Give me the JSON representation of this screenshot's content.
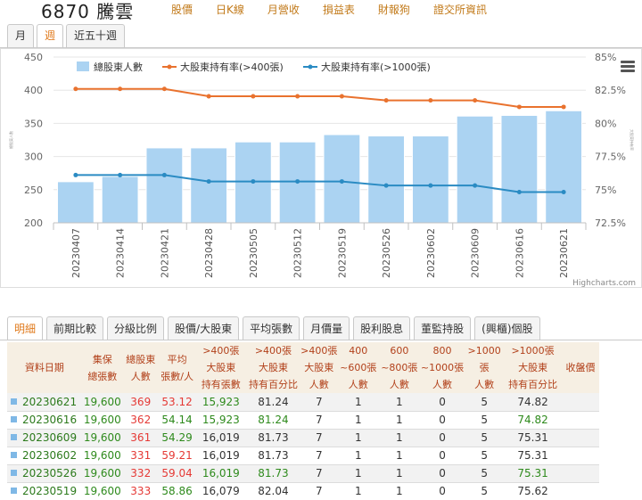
{
  "header": {
    "title": "6870 騰雲",
    "nav": [
      "股價",
      "日K線",
      "月營收",
      "損益表",
      "財報狗",
      "證交所資訊"
    ]
  },
  "period_tabs": [
    {
      "label": "月",
      "active": false
    },
    {
      "label": "週",
      "active": true
    },
    {
      "label": "近五十週",
      "active": false
    }
  ],
  "chart": {
    "credits": "Highcharts.com",
    "legend": {
      "bar": "總股東人數",
      "line400": "大股東持有率(>400張)",
      "line1000": "大股東持有率(>1000張)"
    },
    "left_axis_title": "總股東人數",
    "right_axis_title": "大股東持有率"
  },
  "chart_data": {
    "type": "bar",
    "categories": [
      "20230407",
      "20230414",
      "20230421",
      "20230428",
      "20230505",
      "20230512",
      "20230519",
      "20230526",
      "20230602",
      "20230609",
      "20230616",
      "20230621"
    ],
    "ylim": [
      200,
      450
    ],
    "yticks": [
      200,
      250,
      300,
      350,
      400,
      450
    ],
    "y2lim": [
      72.5,
      85
    ],
    "y2ticks": [
      "72.5%",
      "75%",
      "77.5%",
      "80%",
      "82.5%",
      "85%"
    ],
    "series": [
      {
        "name": "總股東人數",
        "type": "bar",
        "axis": "left",
        "color": "#abd3f2",
        "values": [
          262,
          270,
          313,
          313,
          322,
          322,
          333,
          331,
          331,
          361,
          362,
          369
        ]
      },
      {
        "name": "大股東持有率(>400張)",
        "type": "line",
        "axis": "right",
        "color": "#e9722e",
        "values": [
          82.6,
          82.6,
          82.6,
          82.04,
          82.04,
          82.04,
          82.04,
          81.73,
          81.73,
          81.73,
          81.24,
          81.24
        ]
      },
      {
        "name": "大股東持有率(>1000張)",
        "type": "line",
        "axis": "right",
        "color": "#2a8bc3",
        "values": [
          76.1,
          76.1,
          76.1,
          75.62,
          75.62,
          75.62,
          75.62,
          75.31,
          75.31,
          75.31,
          74.82,
          74.82
        ]
      }
    ]
  },
  "lower_tabs": [
    {
      "label": "明細",
      "active": true
    },
    {
      "label": "前期比較",
      "active": false
    },
    {
      "label": "分級比例",
      "active": false
    },
    {
      "label": "股價/大股東",
      "active": false
    },
    {
      "label": "平均張數",
      "active": false
    },
    {
      "label": "月價量",
      "active": false
    },
    {
      "label": "股利股息",
      "active": false
    },
    {
      "label": "董監持股",
      "active": false
    },
    {
      "label": "(興櫃)個股",
      "active": false
    }
  ],
  "table": {
    "headers": [
      "資料日期",
      "集保總張數",
      "總股東人數",
      "平均張數/人",
      ">400張大股東持有張數",
      ">400張大股東持有百分比",
      ">400張大股東人數",
      "400~600張人數",
      "600~800張人數",
      "800~1000張人數",
      ">1000張人數",
      ">1000張大股東持有百分比",
      "收盤價"
    ],
    "rows": [
      {
        "date": "20230621",
        "total": "19,600",
        "holders": "369",
        "avg": "53.12",
        "h400": "15,923",
        "p400": "81.24",
        "n400": "7",
        "r400_600": "1",
        "r600_800": "1",
        "r800_1000": "0",
        "n1000": "5",
        "p1000": "74.82",
        "close": "",
        "avg_c": "red",
        "h400_c": "green",
        "p400_c": "plain",
        "p1000_c": "plain"
      },
      {
        "date": "20230616",
        "total": "19,600",
        "holders": "362",
        "avg": "54.14",
        "h400": "15,923",
        "p400": "81.24",
        "n400": "7",
        "r400_600": "1",
        "r600_800": "1",
        "r800_1000": "0",
        "n1000": "5",
        "p1000": "74.82",
        "close": "",
        "avg_c": "green",
        "h400_c": "green",
        "p400_c": "green",
        "p1000_c": "green"
      },
      {
        "date": "20230609",
        "total": "19,600",
        "holders": "361",
        "avg": "54.29",
        "h400": "16,019",
        "p400": "81.73",
        "n400": "7",
        "r400_600": "1",
        "r600_800": "1",
        "r800_1000": "0",
        "n1000": "5",
        "p1000": "75.31",
        "close": "",
        "avg_c": "green",
        "h400_c": "plain",
        "p400_c": "plain",
        "p1000_c": "plain"
      },
      {
        "date": "20230602",
        "total": "19,600",
        "holders": "331",
        "avg": "59.21",
        "h400": "16,019",
        "p400": "81.73",
        "n400": "7",
        "r400_600": "1",
        "r600_800": "1",
        "r800_1000": "0",
        "n1000": "5",
        "p1000": "75.31",
        "close": "",
        "avg_c": "red",
        "h400_c": "plain",
        "p400_c": "plain",
        "p1000_c": "plain"
      },
      {
        "date": "20230526",
        "total": "19,600",
        "holders": "332",
        "avg": "59.04",
        "h400": "16,019",
        "p400": "81.73",
        "n400": "7",
        "r400_600": "1",
        "r600_800": "1",
        "r800_1000": "0",
        "n1000": "5",
        "p1000": "75.31",
        "close": "",
        "avg_c": "red",
        "h400_c": "green",
        "p400_c": "green",
        "p1000_c": "green"
      },
      {
        "date": "20230519",
        "total": "19,600",
        "holders": "333",
        "avg": "58.86",
        "h400": "16,079",
        "p400": "82.04",
        "n400": "7",
        "r400_600": "1",
        "r600_800": "1",
        "r800_1000": "0",
        "n1000": "5",
        "p1000": "75.62",
        "close": "",
        "avg_c": "green",
        "h400_c": "plain",
        "p400_c": "plain",
        "p1000_c": "plain"
      }
    ]
  }
}
